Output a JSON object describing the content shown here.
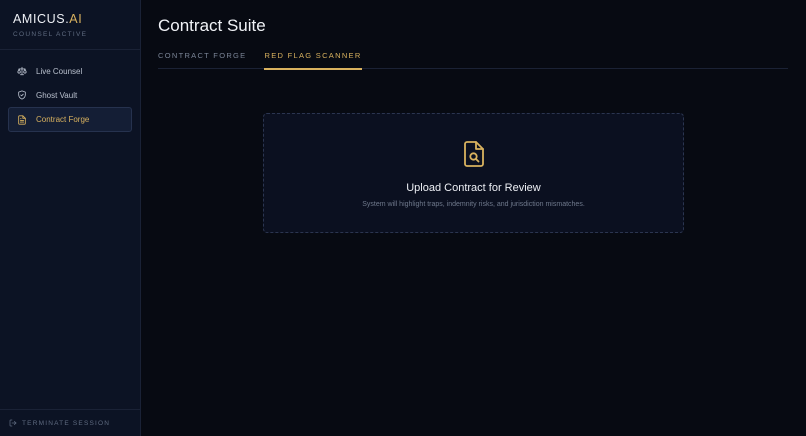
{
  "brand": {
    "name_main": "AMICUS.",
    "name_accent": "AI",
    "status": "COUNSEL ACTIVE"
  },
  "sidebar": {
    "items": [
      {
        "label": "Live Counsel",
        "icon": "scale-icon",
        "active": false
      },
      {
        "label": "Ghost Vault",
        "icon": "shield-icon",
        "active": false
      },
      {
        "label": "Contract Forge",
        "icon": "document-icon",
        "active": true
      }
    ],
    "footer_label": "TERMINATE SESSION"
  },
  "main": {
    "title": "Contract Suite",
    "tabs": [
      {
        "label": "CONTRACT FORGE",
        "active": false
      },
      {
        "label": "RED FLAG SCANNER",
        "active": true
      }
    ],
    "upload": {
      "icon": "file-search-icon",
      "title": "Upload Contract for Review",
      "subtitle": "System will highlight traps, indemnity risks, and jurisdiction mismatches."
    }
  },
  "colors": {
    "accent": "#d9b25f",
    "background": "#070a12",
    "sidebar": "#0c1324"
  }
}
